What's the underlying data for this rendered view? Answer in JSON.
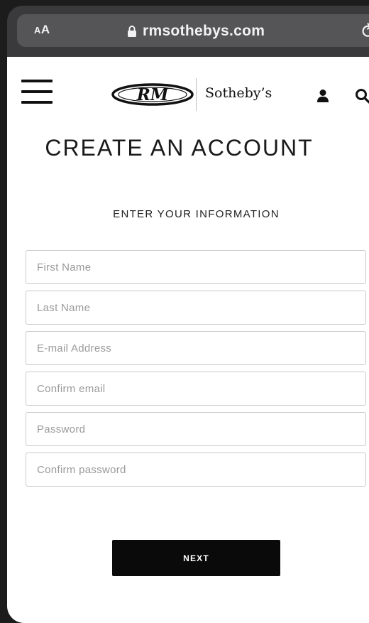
{
  "browser": {
    "text_size_label_small": "A",
    "text_size_label_large": "A",
    "domain": "rmsothebys.com"
  },
  "header": {
    "brand_mark": "RM",
    "brand_name": "Sotheby’s"
  },
  "main": {
    "title": "CREATE AN ACCOUNT",
    "section_label": "ENTER YOUR INFORMATION",
    "fields": [
      {
        "placeholder": "First Name",
        "value": ""
      },
      {
        "placeholder": "Last Name",
        "value": ""
      },
      {
        "placeholder": "E-mail Address",
        "value": ""
      },
      {
        "placeholder": "Confirm email",
        "value": ""
      },
      {
        "placeholder": "Password",
        "value": ""
      },
      {
        "placeholder": "Confirm password",
        "value": ""
      }
    ],
    "next_label": "NEXT"
  },
  "icons": {
    "menu": "hamburger-menu-icon",
    "account": "user-icon",
    "search": "search-icon",
    "lock": "lock-icon",
    "reload": "reload-icon"
  },
  "colors": {
    "browser_chrome": "#3a3a3c",
    "url_field": "#555557",
    "page_background": "#ffffff",
    "button_background": "#0a0a0a",
    "field_border": "#c9c9c9"
  }
}
